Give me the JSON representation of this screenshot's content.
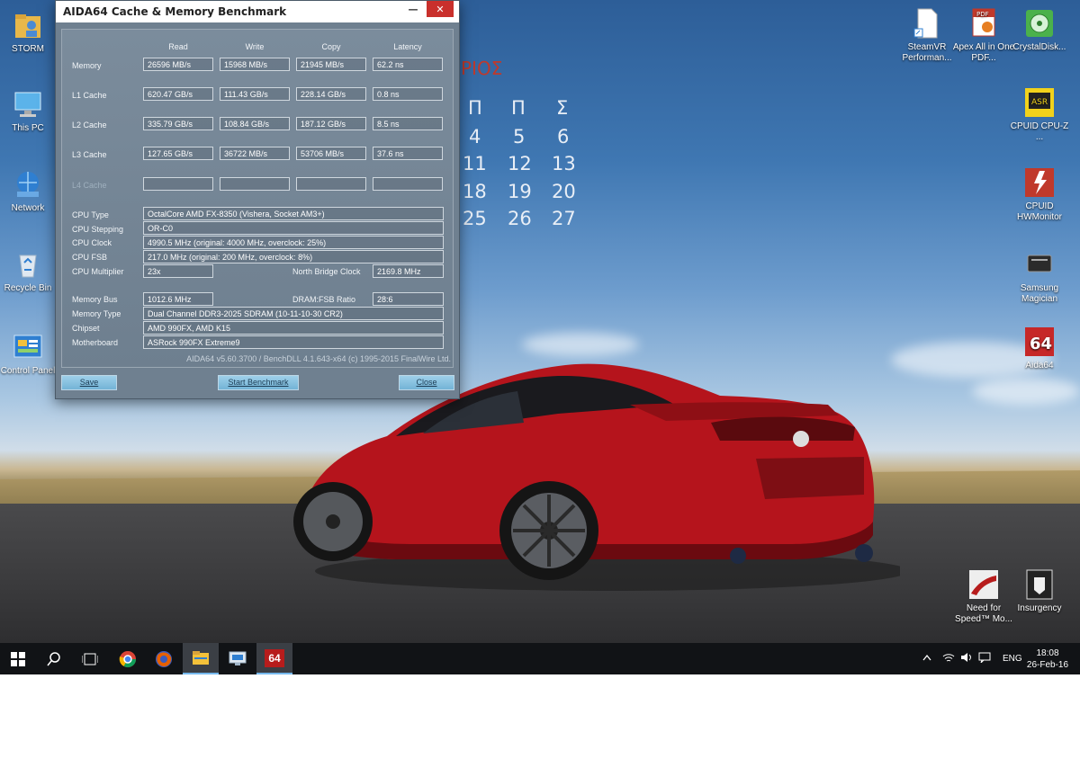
{
  "window": {
    "title": "AIDA64 Cache & Memory Benchmark",
    "minimize_glyph": "—",
    "close_glyph": "✕",
    "columns": [
      "Read",
      "Write",
      "Copy",
      "Latency"
    ],
    "rows": [
      {
        "label": "Memory",
        "read": "26596 MB/s",
        "write": "15968 MB/s",
        "copy": "21945 MB/s",
        "latency": "62.2 ns"
      },
      {
        "label": "L1 Cache",
        "read": "620.47 GB/s",
        "write": "111.43 GB/s",
        "copy": "228.14 GB/s",
        "latency": "0.8 ns"
      },
      {
        "label": "L2 Cache",
        "read": "335.79 GB/s",
        "write": "108.84 GB/s",
        "copy": "187.12 GB/s",
        "latency": "8.5 ns"
      },
      {
        "label": "L3 Cache",
        "read": "127.65 GB/s",
        "write": "36722 MB/s",
        "copy": "53706 MB/s",
        "latency": "37.6 ns"
      },
      {
        "label": "L4 Cache",
        "read": "",
        "write": "",
        "copy": "",
        "latency": ""
      }
    ],
    "info": {
      "cpu_type_label": "CPU Type",
      "cpu_type": "OctalCore AMD FX-8350  (Vishera, Socket AM3+)",
      "cpu_stepping_label": "CPU Stepping",
      "cpu_stepping": "OR-C0",
      "cpu_clock_label": "CPU Clock",
      "cpu_clock": "4990.5 MHz  (original: 4000 MHz, overclock: 25%)",
      "cpu_fsb_label": "CPU FSB",
      "cpu_fsb": "217.0 MHz  (original: 200 MHz, overclock: 8%)",
      "cpu_multiplier_label": "CPU Multiplier",
      "cpu_multiplier": "23x",
      "nb_clock_label": "North Bridge Clock",
      "nb_clock": "2169.8 MHz",
      "memory_bus_label": "Memory Bus",
      "memory_bus": "1012.6 MHz",
      "dram_fsb_label": "DRAM:FSB Ratio",
      "dram_fsb": "28:6",
      "memory_type_label": "Memory Type",
      "memory_type": "Dual Channel DDR3-2025 SDRAM  (10-11-10-30 CR2)",
      "chipset_label": "Chipset",
      "chipset": "AMD 990FX, AMD K15",
      "motherboard_label": "Motherboard",
      "motherboard": "ASRock 990FX Extreme9"
    },
    "footer_note": "AIDA64 v5.60.3700 / BenchDLL 4.1.643-x64  (c) 1995-2015 FinalWire Ltd.",
    "buttons": {
      "save": "Save",
      "start": "Start Benchmark",
      "close": "Close"
    }
  },
  "calendar": {
    "title": "ΡΙΟΣ",
    "headers": [
      "Π",
      "Π",
      "Σ"
    ],
    "weeks": [
      [
        "4",
        "5",
        "6"
      ],
      [
        "11",
        "12",
        "13"
      ],
      [
        "18",
        "19",
        "20"
      ],
      [
        "25",
        "26",
        "27"
      ]
    ]
  },
  "desktop_left": [
    {
      "label": "STORM",
      "icon": "user-folder-icon"
    },
    {
      "label": "This PC",
      "icon": "computer-icon"
    },
    {
      "label": "Network",
      "icon": "network-icon"
    },
    {
      "label": "Recycle Bin",
      "icon": "recycle-bin-icon"
    },
    {
      "label": "Control Panel",
      "icon": "control-panel-icon"
    }
  ],
  "desktop_right": [
    {
      "label": "SteamVR Performan...",
      "icon": "document-icon"
    },
    {
      "label": "Apex All in One PDF...",
      "icon": "pdf-icon"
    },
    {
      "label": "CrystalDisk...",
      "icon": "crystaldisk-icon"
    },
    {
      "label": "CPUID CPU-Z ...",
      "icon": "cpuz-icon"
    },
    {
      "label": "CPUID HWMonitor",
      "icon": "hwmonitor-icon"
    },
    {
      "label": "Samsung Magician",
      "icon": "samsung-magician-icon"
    },
    {
      "label": "Aida64",
      "icon": "aida64-icon"
    },
    {
      "label": "Need for Speed™ Mo...",
      "icon": "nfs-icon"
    },
    {
      "label": "Insurgency",
      "icon": "insurgency-icon"
    }
  ],
  "taskbar": {
    "aida_label": "64",
    "language": "ENG",
    "time": "18:08",
    "date": "26-Feb-16"
  },
  "colors": {
    "accent": "#76b9ed",
    "aida_red": "#b71c1c",
    "close_red": "#c9302c"
  }
}
